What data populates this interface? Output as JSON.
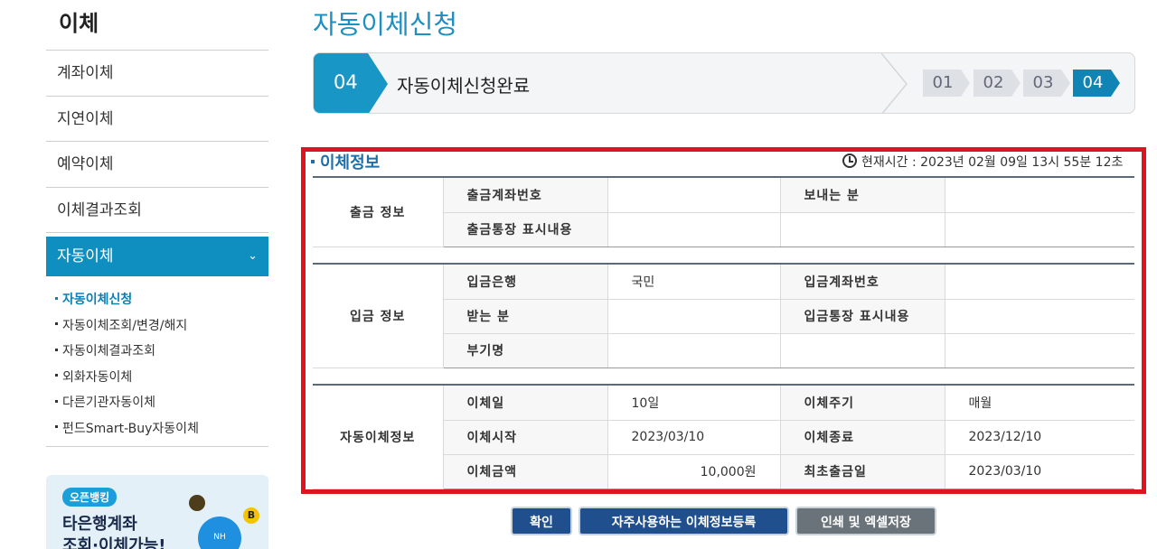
{
  "sidebar": {
    "title": "이체",
    "menu": [
      {
        "label": "계좌이체"
      },
      {
        "label": "지연이체"
      },
      {
        "label": "예약이체"
      },
      {
        "label": "이체결과조회"
      },
      {
        "label": "자동이체"
      }
    ],
    "submenu": [
      {
        "label": "자동이체신청"
      },
      {
        "label": "자동이체조회/변경/해지"
      },
      {
        "label": "자동이체결과조회"
      },
      {
        "label": "외화자동이체"
      },
      {
        "label": "다른기관자동이체"
      },
      {
        "label": "펀드Smart-Buy자동이체"
      }
    ],
    "banner": {
      "badge": "오픈뱅킹",
      "line1": "타은행계좌",
      "line2": "조회·이체가능!",
      "nh": "NH",
      "coin": "B"
    }
  },
  "page_title": "자동이체신청",
  "steps": {
    "current_num": "04",
    "current_label": "자동이체신청완료",
    "chips": [
      "01",
      "02",
      "03",
      "04"
    ],
    "active_index": 3
  },
  "section": {
    "title": "이체정보",
    "clock_text": "현재시간 : 2023년 02월 09일 13시 55분 12초"
  },
  "withdraw": {
    "group": "출금 정보",
    "account_label": "출금계좌번호",
    "account_value": "",
    "sender_label": "보내는 분",
    "sender_value": "",
    "memo_label": "출금통장 표시내용",
    "memo_value": ""
  },
  "deposit": {
    "group": "입금 정보",
    "bank_label": "입금은행",
    "bank_value": "국민",
    "account_label": "입금계좌번호",
    "account_value": "",
    "receiver_label": "받는 분",
    "receiver_value": "",
    "memo_label": "입금통장 표시내용",
    "memo_value": "",
    "extra_label": "부기명",
    "extra_value": ""
  },
  "auto": {
    "group": "자동이체정보",
    "day_label": "이체일",
    "day_value": "10일",
    "cycle_label": "이체주기",
    "cycle_value": "매월",
    "start_label": "이체시작",
    "start_value": "2023/03/10",
    "end_label": "이체종료",
    "end_value": "2023/12/10",
    "amount_label": "이체금액",
    "amount_value": "10,000원",
    "first_label": "최초출금일",
    "first_value": "2023/03/10"
  },
  "buttons": {
    "confirm": "확인",
    "register": "자주사용하는 이체정보등록",
    "print": "인쇄 및 엑셀저장"
  },
  "colors": {
    "accent": "#1e8fbf",
    "highlight_frame": "#e0141c",
    "amount": "#d2541b"
  }
}
